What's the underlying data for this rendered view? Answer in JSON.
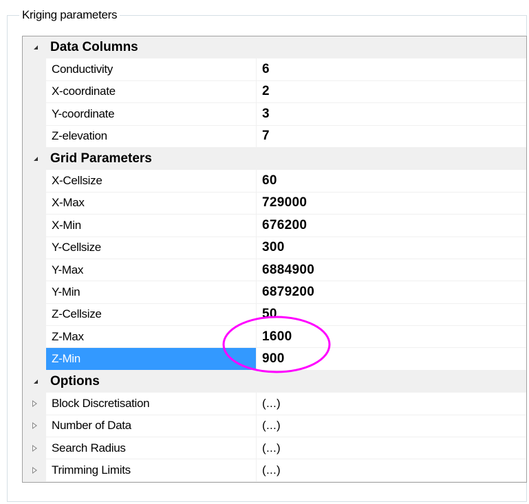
{
  "groupbox": {
    "title": "Kriging parameters"
  },
  "categories": [
    {
      "label": "Data Columns",
      "rows": [
        {
          "name": "Conductivity",
          "value": "6"
        },
        {
          "name": "X-coordinate",
          "value": "2"
        },
        {
          "name": "Y-coordinate",
          "value": "3"
        },
        {
          "name": "Z-elevation",
          "value": "7"
        }
      ]
    },
    {
      "label": "Grid Parameters",
      "rows": [
        {
          "name": "X-Cellsize",
          "value": "60"
        },
        {
          "name": "X-Max",
          "value": "729000"
        },
        {
          "name": "X-Min",
          "value": "676200"
        },
        {
          "name": "Y-Cellsize",
          "value": "300"
        },
        {
          "name": "Y-Max",
          "value": "6884900"
        },
        {
          "name": "Y-Min",
          "value": "6879200"
        },
        {
          "name": "Z-Cellsize",
          "value": "50"
        },
        {
          "name": "Z-Max",
          "value": "1600"
        },
        {
          "name": "Z-Min",
          "value": "900"
        }
      ]
    },
    {
      "label": "Options",
      "rows": [
        {
          "name": "Block Discretisation",
          "value": "(...)"
        },
        {
          "name": "Number of Data",
          "value": "(...)"
        },
        {
          "name": "Search Radius",
          "value": "(...)"
        },
        {
          "name": "Trimming Limits",
          "value": "(...)"
        }
      ]
    }
  ],
  "selected_row": "Z-Min",
  "colors": {
    "selection": "#3399ff",
    "highlight_ellipse": "#ff00ff",
    "category_bg": "#f0f0f0"
  },
  "icons": {
    "expanded": "triangle-down-icon",
    "collapsed": "triangle-right-icon"
  }
}
